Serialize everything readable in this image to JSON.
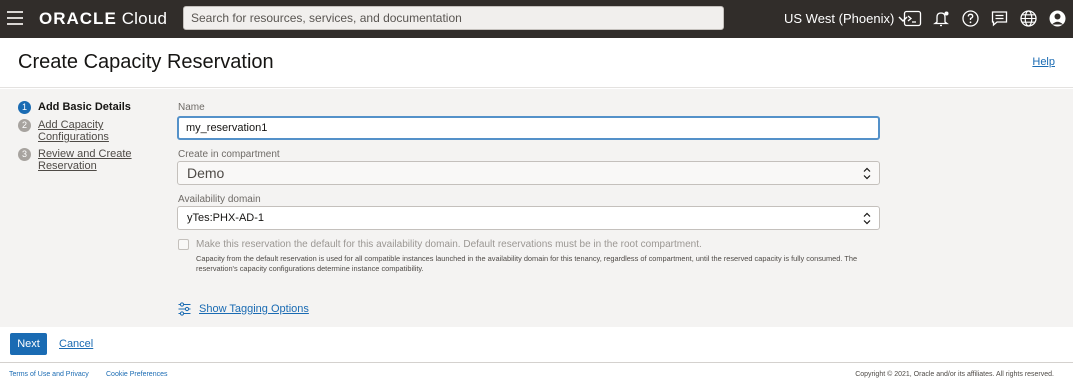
{
  "topbar": {
    "brand_bold": "ORACLE",
    "brand_light": " Cloud",
    "search_placeholder": "Search for resources, services, and documentation",
    "region": "US West (Phoenix)",
    "icons": [
      "hamburger-menu-icon",
      "cloud-shell-icon",
      "bell-icon",
      "help-icon",
      "chat-icon",
      "globe-icon",
      "user-icon"
    ]
  },
  "header": {
    "title": "Create Capacity Reservation",
    "help": "Help"
  },
  "steps": [
    {
      "num": "1",
      "label": "Add Basic Details",
      "state": "active"
    },
    {
      "num": "2",
      "label": "Add Capacity Configurations",
      "state": "inactive"
    },
    {
      "num": "3",
      "label": "Review and Create Reservation",
      "state": "inactive"
    }
  ],
  "form": {
    "name_label": "Name",
    "name_value": "my_reservation1",
    "compartment_label": "Create in compartment",
    "compartment_value": "Demo",
    "ad_label": "Availability domain",
    "ad_value": "yTes:PHX-AD-1",
    "default_label": "Make this reservation the default for this availability domain. Default reservations must be in the root compartment.",
    "default_help": "Capacity from the default reservation is used for all compatible instances launched in the availability domain for this tenancy, regardless of compartment, until the reserved capacity is fully consumed. The reservation's capacity configurations determine instance compatibility.",
    "tagging": "Show Tagging Options"
  },
  "actions": {
    "next": "Next",
    "cancel": "Cancel"
  },
  "footer": {
    "terms": "Terms of Use and Privacy",
    "cookies": "Cookie Preferences",
    "copyright": "Copyright © 2021, Oracle and/or its affiliates. All rights reserved."
  },
  "colors": {
    "topbar": "#312d2a",
    "accent": "#1a6bb3",
    "body_bg": "#f4f3f2"
  }
}
